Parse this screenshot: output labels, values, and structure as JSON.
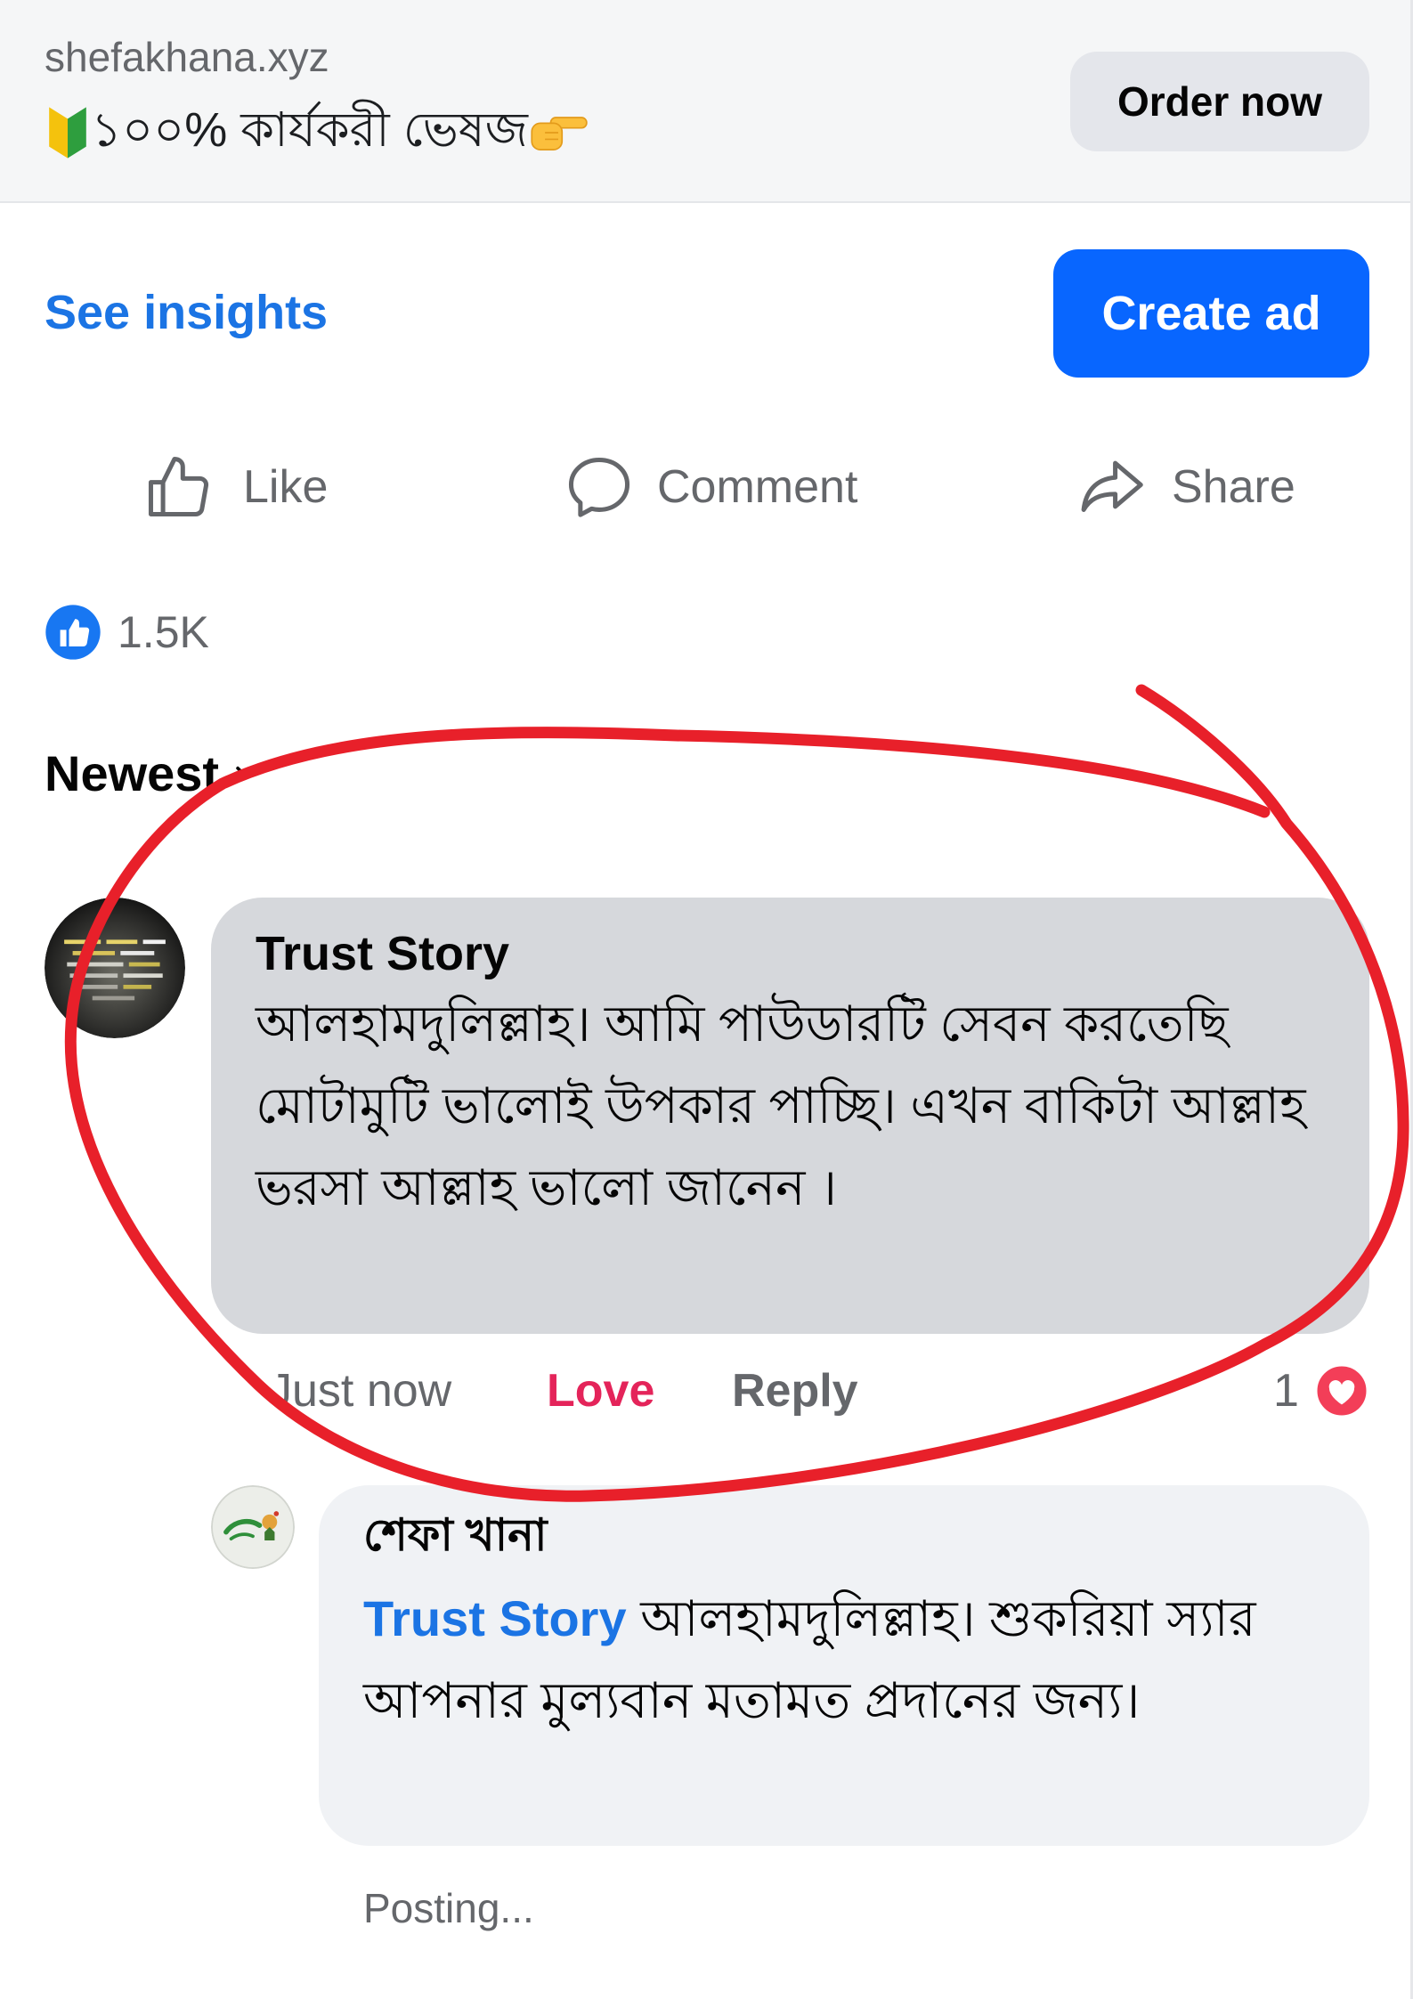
{
  "ad_header": {
    "domain": "shefakhana.xyz",
    "headline_prefix_icon": "beginner-symbol-icon",
    "headline": "১০০% কার্যকরী ভেষজ",
    "headline_suffix_icon": "pointing-hand-icon",
    "cta_label": "Order now"
  },
  "promo_actions": {
    "insights_label": "See insights",
    "create_ad_label": "Create ad"
  },
  "post_actions": [
    {
      "label": "Like",
      "icon": "thumbs-up-outline-icon"
    },
    {
      "label": "Comment",
      "icon": "comment-bubble-icon"
    },
    {
      "label": "Share",
      "icon": "share-arrow-icon"
    }
  ],
  "reactions": {
    "icon": "like-reaction-icon",
    "count": "1.5K"
  },
  "comments_filter": {
    "label": "Newest",
    "icon": "chevron-down-icon"
  },
  "comments": [
    {
      "author": "Trust Story",
      "text": "আলহামদুলিল্লাহ। আমি পাউডারটি  সেবন করতেছি মোটামুটি ভালোই উপকার পাচ্ছি। এখন বাকিটা আল্লাহ ভরসা আল্লাহ ভালো জানেন ।",
      "time": "Just now",
      "reaction_label": "Love",
      "reply_label": "Reply",
      "reaction_count": "1",
      "reaction_icon": "love-reaction-icon",
      "reply": {
        "author": "শেফা খানা",
        "mention": "Trust Story",
        "text": "আলহামদুলিল্লাহ। শুকরিয়া স্যার আপনার মুল্যবান মতামত প্রদানের জন্য।",
        "status": "Posting..."
      }
    }
  ],
  "annotation": {
    "color": "#e8202a"
  },
  "colors": {
    "primary_blue": "#0866ff",
    "link_blue": "#1b74e4",
    "love_pink": "#e4245a",
    "secondary_text": "#65676b"
  }
}
